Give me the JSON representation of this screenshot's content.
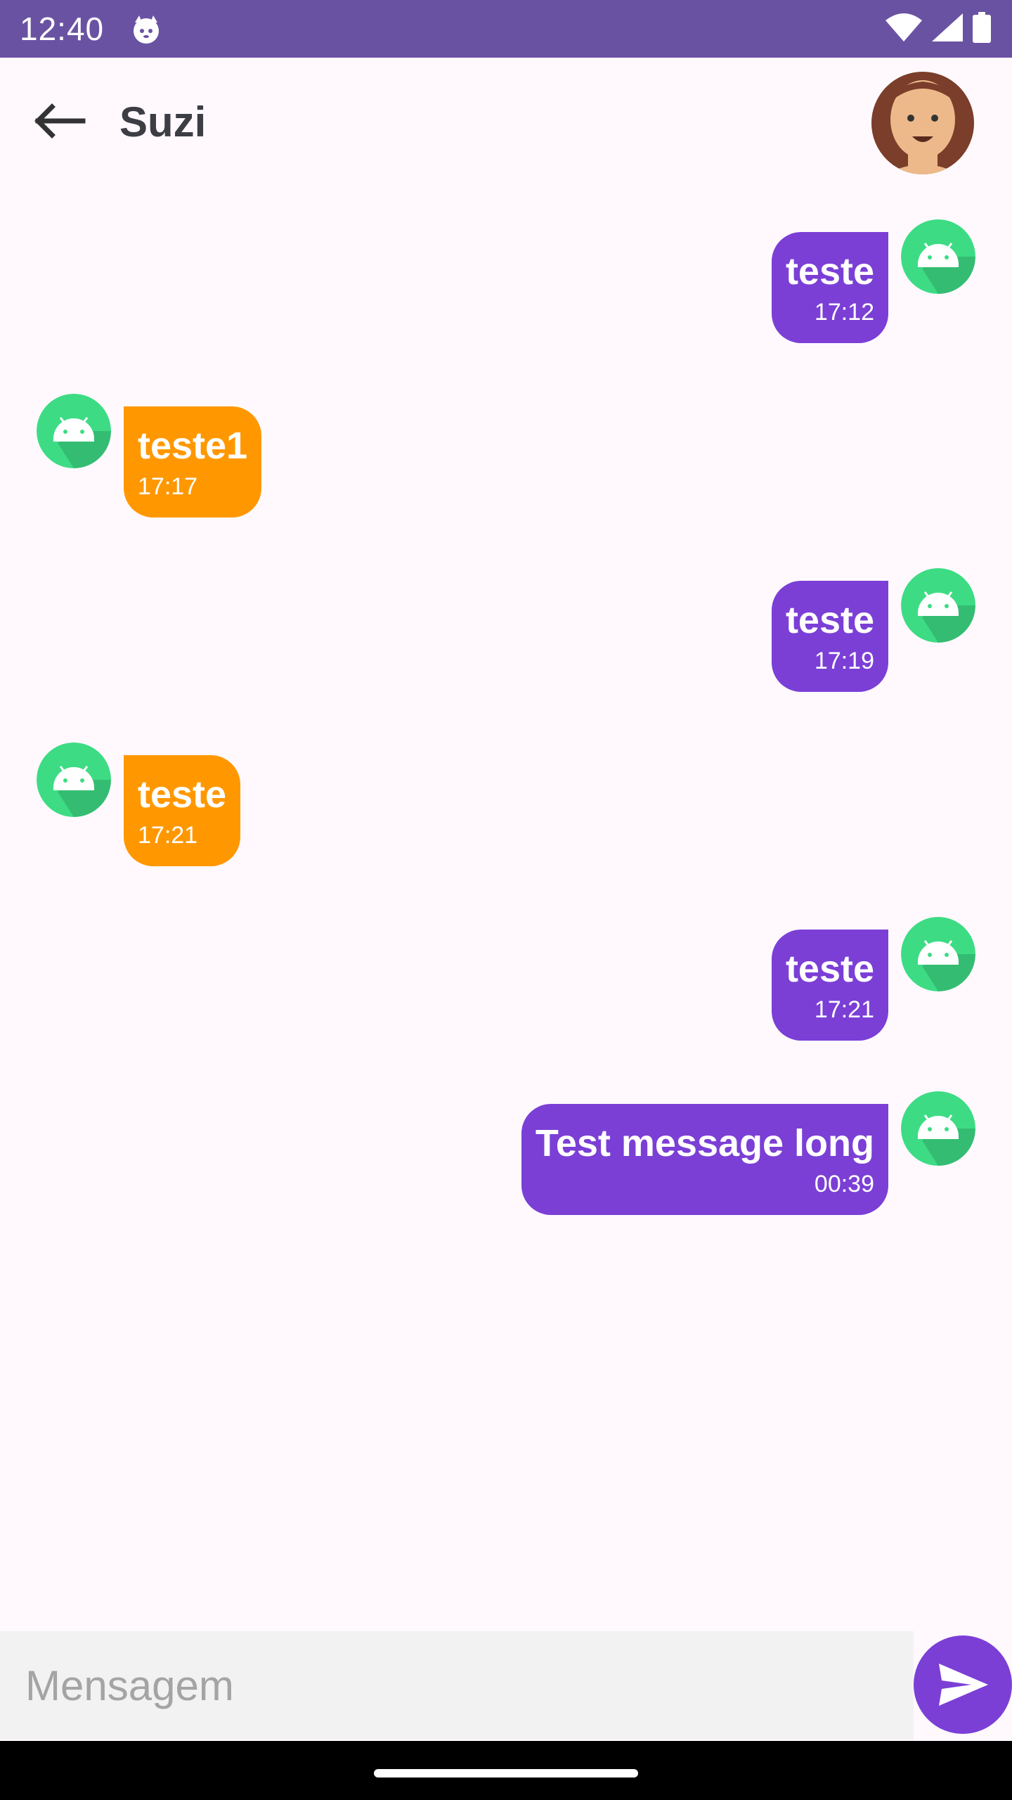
{
  "status_bar": {
    "time": "12:40",
    "app_icon": "cat-face-icon",
    "icons": [
      "wifi-icon",
      "cellular-signal-icon",
      "battery-icon"
    ]
  },
  "header": {
    "back_icon": "arrow-left-icon",
    "title": "Suzi",
    "avatar": "smiling-woman-avatar"
  },
  "messages": [
    {
      "side": "sent",
      "text": "teste",
      "time": "17:12"
    },
    {
      "side": "received",
      "text": "teste1",
      "time": "17:17"
    },
    {
      "side": "sent",
      "text": "teste",
      "time": "17:19"
    },
    {
      "side": "received",
      "text": "teste",
      "time": "17:21"
    },
    {
      "side": "sent",
      "text": "teste",
      "time": "17:21"
    },
    {
      "side": "sent",
      "text": "Test message long",
      "time": "00:39"
    }
  ],
  "composer": {
    "placeholder": "Mensagem",
    "value": "",
    "send_icon": "send-icon"
  },
  "colors": {
    "status_bar": "#6A52A3",
    "sent_bubble": "#7B3FD6",
    "received_bubble": "#FF9800",
    "avatar_green": "#3DDC84",
    "send_button": "#7B3FD6"
  }
}
